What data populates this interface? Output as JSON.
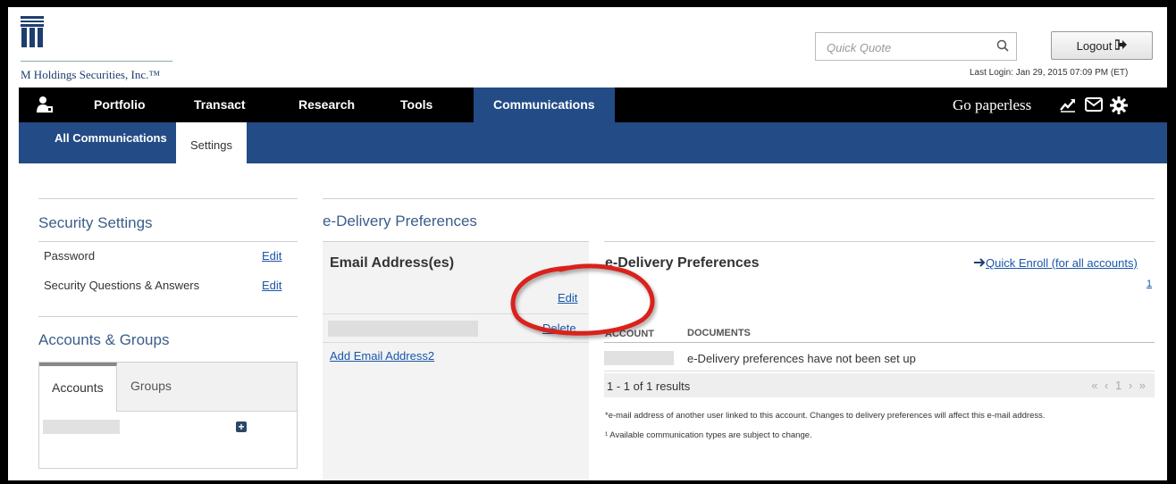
{
  "header": {
    "company": "M Holdings Securities, Inc.™",
    "search_placeholder": "Quick Quote",
    "logout_label": "Logout",
    "last_login": "Last Login: Jan 29, 2015 07:09 PM (ET)"
  },
  "nav": {
    "items": [
      "Portfolio",
      "Transact",
      "Research",
      "Tools",
      "Communications"
    ],
    "go_paperless": "Go paperless"
  },
  "subnav": {
    "items": [
      "All Communications",
      "Settings"
    ]
  },
  "security": {
    "title": "Security Settings",
    "rows": [
      {
        "label": "Password",
        "action": "Edit"
      },
      {
        "label": "Security Questions & Answers",
        "action": "Edit"
      }
    ]
  },
  "accounts_groups": {
    "title": "Accounts & Groups",
    "tabs": [
      "Accounts",
      "Groups"
    ]
  },
  "edelivery": {
    "section_title": "e-Delivery Preferences",
    "email_title": "Email Address(es)",
    "edit_label": "Edit",
    "delete_label": "Delete",
    "add_email_label": "Add Email Address2",
    "panel_title": "e-Delivery Preferences",
    "quick_enroll": "Quick Enroll (for all accounts)",
    "footnote_marker": "1",
    "columns": [
      "ACCOUNT",
      "DOCUMENTS"
    ],
    "row_message": "e-Delivery preferences have not been set up",
    "results": "1 - 1 of 1 results",
    "pager": "« ‹ 1 › »",
    "note1": "*e-mail address of another user linked to this account. Changes to delivery preferences will affect this e-mail address.",
    "note2": "¹ Available communication types are subject to change."
  },
  "annotation_color": "#d9201b"
}
